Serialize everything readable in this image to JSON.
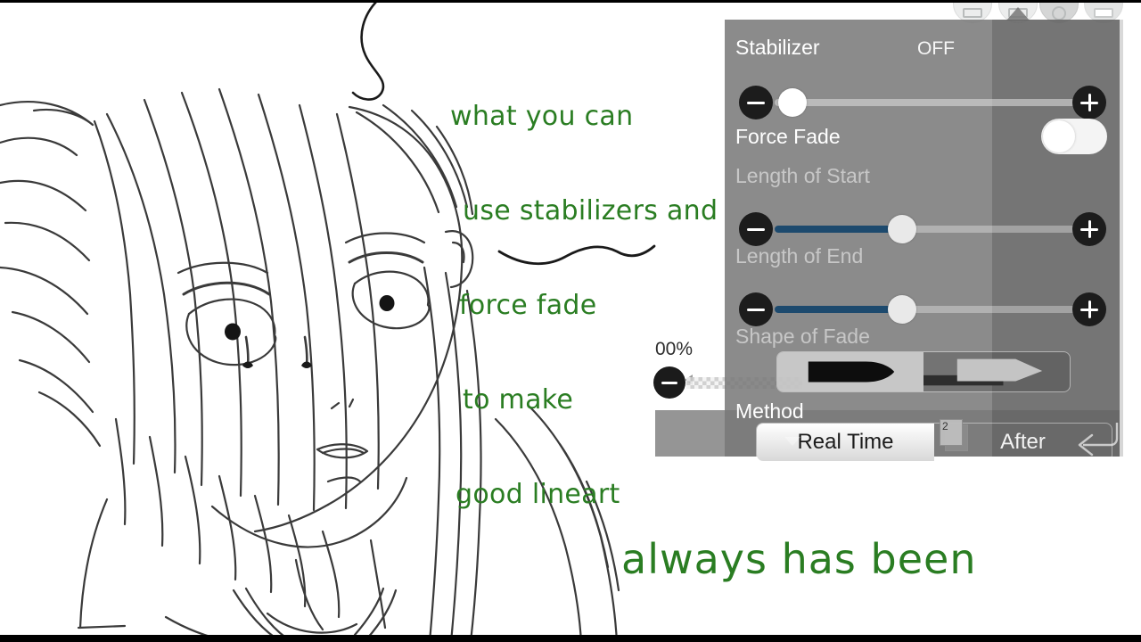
{
  "app": {
    "canvas_bg": "#ffffff",
    "accent_green": "#2a7d22",
    "panel_bg": "#787878",
    "slider_fill": "#1d4a6e"
  },
  "captions": {
    "top": {
      "lines": [
        "what you can",
        "use stabilizers and",
        "force fade",
        "to make",
        "good lineart"
      ]
    },
    "bottom": "always has been"
  },
  "toolbar": {
    "buttons": [
      {
        "name": "eraser-tool-button"
      },
      {
        "name": "brush-tool-button"
      },
      {
        "name": "color-tool-button"
      },
      {
        "name": "layer-tool-button"
      }
    ]
  },
  "sub_panel": {
    "opacity_value": "00%",
    "minus_label": "−"
  },
  "panel": {
    "rows": {
      "stabilizer": {
        "label": "Stabilizer",
        "value": "OFF",
        "slider_percent": 2,
        "minus_label": "−",
        "plus_label": "+"
      },
      "force_fade": {
        "label": "Force Fade",
        "toggle_state": "on"
      },
      "length_of_start": {
        "label": "Length of Start",
        "slider_percent": 42,
        "minus_label": "−",
        "plus_label": "+"
      },
      "length_of_end": {
        "label": "Length of End",
        "slider_percent": 42,
        "minus_label": "−",
        "plus_label": "+"
      },
      "shape_of_fade": {
        "label": "Shape of Fade",
        "options": [
          {
            "name": "shape-bullet",
            "selected": true
          },
          {
            "name": "shape-taper",
            "selected": false
          }
        ]
      },
      "method": {
        "label": "Method",
        "badge": "2",
        "options": [
          {
            "label": "Real Time",
            "selected": true
          },
          {
            "label": "After",
            "selected": false
          }
        ]
      }
    }
  }
}
